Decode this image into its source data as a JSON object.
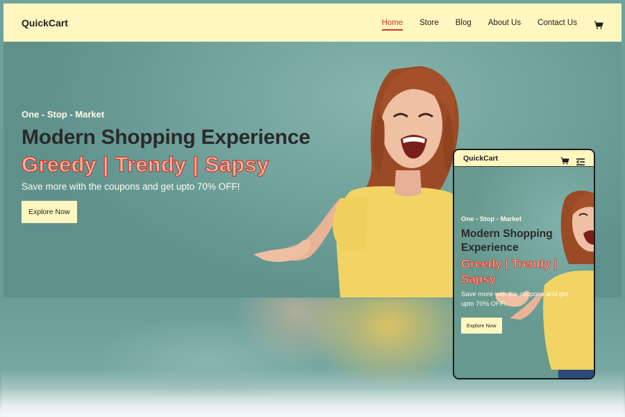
{
  "brand": "QuickCart",
  "nav": {
    "items": [
      "Home",
      "Store",
      "Blog",
      "About Us",
      "Contact Us"
    ],
    "active": "Home"
  },
  "hero": {
    "eyebrow": "One - Stop - Market",
    "headline": "Modern Shopping Experience",
    "tagline": "Greedy | Trendy | Sapsy",
    "subtext": "Save more with the coupons and get upto 70% OFF!",
    "cta_label": "Explore Now"
  },
  "mobile": {
    "brand": "QuickCart",
    "eyebrow": "One - Stop - Market",
    "headline_line1": "Modern Shopping",
    "headline_line2": "Experience",
    "tagline_line1": "Greedy | Trendy |",
    "tagline_line2": "Sapsy",
    "subtext_line1": "Save more with the coupons and get",
    "subtext_line2": "upto 70% OFF!",
    "cta_label": "Explore Now"
  },
  "icons": {
    "cart": "cart-icon",
    "menu": "menu-icon"
  },
  "colors": {
    "navbar_bg": "#fff6c0",
    "hero_bg": "#6b9c97",
    "accent_red": "#d6352c",
    "tagline_fill": "#f7b49f",
    "shirt_yellow": "#f2d464"
  }
}
